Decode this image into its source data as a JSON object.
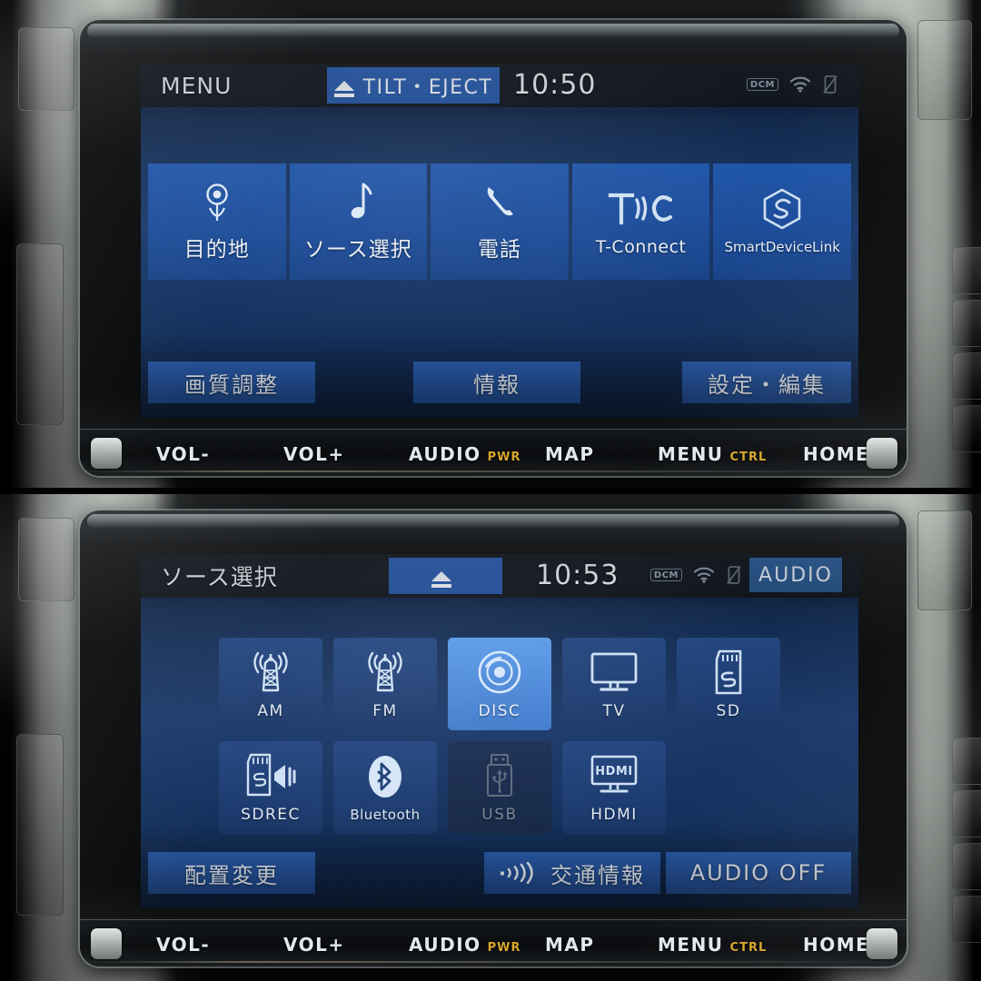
{
  "device": {
    "type": "car-navigation-head-unit",
    "hardware_keys": [
      {
        "label": "VOL-",
        "sub": ""
      },
      {
        "label": "VOL+",
        "sub": ""
      },
      {
        "label": "AUDIO",
        "sub": "PWR"
      },
      {
        "label": "MAP",
        "sub": ""
      },
      {
        "label": "MENU",
        "sub": "CTRL"
      },
      {
        "label": "HOME",
        "sub": ""
      }
    ]
  },
  "colors": {
    "accent_blue": "#1f55a8",
    "selected_blue": "#4a87d8",
    "button_blue": "#2a5cac",
    "tile_blue": "#1d3d72",
    "disabled_tile": "#172947",
    "text_light": "#e9eff7",
    "key_amber": "#d8a62c"
  },
  "top_screen": {
    "statusbar": {
      "title": "MENU",
      "eject_label": "TILT・EJECT",
      "eject_icon": "eject-icon",
      "clock": "10:50",
      "icons": [
        "dcm-badge",
        "wifi-icon",
        "phone-off-icon"
      ],
      "dcm_text": "DCM"
    },
    "menu_tiles": [
      {
        "label": "目的地",
        "icon": "map-pin-icon",
        "style": "jp"
      },
      {
        "label": "ソース選択",
        "icon": "music-note-icon",
        "style": "jp"
      },
      {
        "label": "電話",
        "icon": "phone-handset-icon",
        "style": "jp"
      },
      {
        "label": "T-Connect",
        "icon": "t-connect-icon",
        "style": "lat"
      },
      {
        "label": "SmartDeviceLink",
        "icon": "smartdevicelink-icon",
        "style": "sml"
      }
    ],
    "bottom_buttons": [
      {
        "label": "画質調整",
        "icon": ""
      },
      {
        "label": "情報",
        "icon": ""
      },
      {
        "label": "設定・編集",
        "icon": ""
      }
    ]
  },
  "bottom_screen": {
    "statusbar": {
      "title": "ソース選択",
      "eject_label": "",
      "eject_icon": "eject-icon",
      "clock": "10:53",
      "icons": [
        "dcm-badge",
        "wifi-icon",
        "phone-off-icon"
      ],
      "dcm_text": "DCM",
      "audio_badge": "AUDIO"
    },
    "source_tiles_row1": [
      {
        "label": "AM",
        "icon": "radio-tower-icon",
        "state": "normal"
      },
      {
        "label": "FM",
        "icon": "radio-tower-icon",
        "state": "normal"
      },
      {
        "label": "DISC",
        "icon": "disc-icon",
        "state": "selected"
      },
      {
        "label": "TV",
        "icon": "tv-icon",
        "state": "normal"
      },
      {
        "label": "SD",
        "icon": "sd-card-icon",
        "state": "normal"
      }
    ],
    "source_tiles_row2": [
      {
        "label": "SDREC",
        "icon": "sd-record-icon",
        "state": "normal"
      },
      {
        "label": "Bluetooth",
        "icon": "bluetooth-icon",
        "state": "normal"
      },
      {
        "label": "USB",
        "icon": "usb-icon",
        "state": "disabled"
      },
      {
        "label": "HDMI",
        "icon": "hdmi-icon",
        "state": "normal"
      }
    ],
    "bottom_buttons": [
      {
        "label": "配置変更",
        "icon": ""
      },
      {
        "label": "交通情報",
        "icon": "traffic-signal-icon"
      },
      {
        "label": "AUDIO OFF",
        "icon": ""
      }
    ]
  }
}
